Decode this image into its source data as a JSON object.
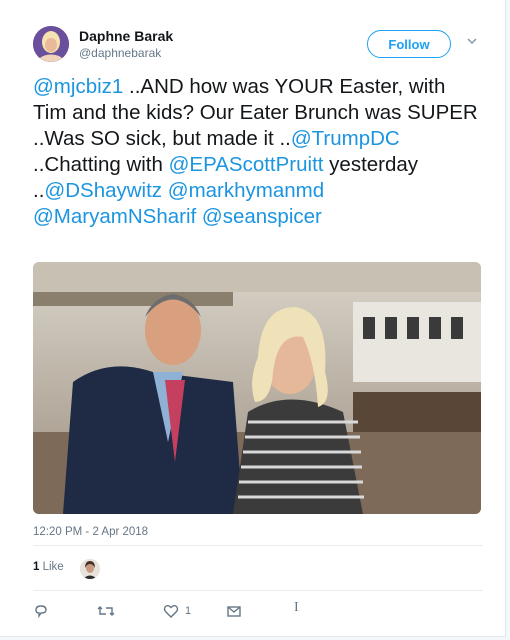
{
  "author": {
    "name": "Daphne Barak",
    "handle": "@daphnebarak"
  },
  "follow_label": "Follow",
  "tweet": {
    "segments": [
      {
        "text": "@mjcbiz1",
        "link": true
      },
      {
        "text": "  ..AND how was YOUR Easter, with Tim and the kids?  Our Eater Brunch was SUPER ..Was SO sick, but made it ..",
        "link": false
      },
      {
        "text": "@TrumpDC",
        "link": true
      },
      {
        "text": " ..Chatting with ",
        "link": false
      },
      {
        "text": "@EPAScottPruitt",
        "link": true
      },
      {
        "text": " yesterday ..",
        "link": false
      },
      {
        "text": "@DShaywitz",
        "link": true
      },
      {
        "text": " ",
        "link": false
      },
      {
        "text": "@markhymanmd",
        "link": true
      },
      {
        "text": " ",
        "link": false
      },
      {
        "text": "@MaryamNSharif",
        "link": true
      },
      {
        "text": " ",
        "link": false
      },
      {
        "text": "@seanspicer",
        "link": true
      }
    ]
  },
  "timestamp": "12:20 PM - 2 Apr 2018",
  "likes": {
    "count": "1",
    "label": "Like"
  },
  "actions": {
    "like_count": "1"
  },
  "icons": {
    "reply": "reply-icon",
    "retweet": "retweet-icon",
    "like": "heart-icon",
    "dm": "envelope-icon",
    "more": "chevron-down-icon"
  },
  "colors": {
    "link": "#1b95e0",
    "accent": "#1da1f2",
    "muted": "#657786"
  }
}
